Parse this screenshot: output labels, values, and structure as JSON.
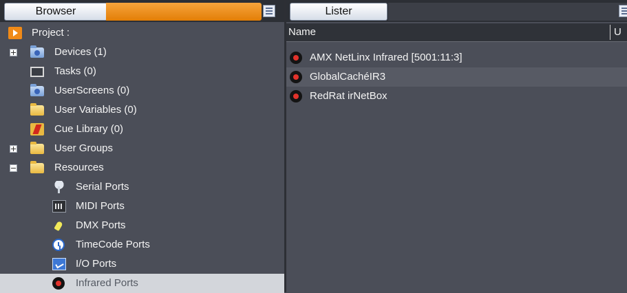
{
  "browser": {
    "tab_label": "Browser",
    "tree": [
      {
        "label": "Project :",
        "icon": "project-icon",
        "expander": null,
        "indent": 0
      },
      {
        "label": "Devices (1)",
        "icon": "devices-folder-icon",
        "expander": "plus",
        "indent": 1
      },
      {
        "label": "Tasks (0)",
        "icon": "tasks-icon",
        "expander": null,
        "indent": 1
      },
      {
        "label": "UserScreens (0)",
        "icon": "userscreens-folder-icon",
        "expander": null,
        "indent": 1
      },
      {
        "label": "User Variables (0)",
        "icon": "folder-icon",
        "expander": null,
        "indent": 1
      },
      {
        "label": "Cue Library (0)",
        "icon": "cue-library-icon",
        "expander": null,
        "indent": 1
      },
      {
        "label": "User Groups",
        "icon": "folder-icon",
        "expander": "plus",
        "indent": 1
      },
      {
        "label": "Resources",
        "icon": "folder-icon",
        "expander": "minus",
        "indent": 1
      },
      {
        "label": "Serial Ports",
        "icon": "serial-port-icon",
        "expander": null,
        "indent": 2
      },
      {
        "label": "MIDI Ports",
        "icon": "midi-port-icon",
        "expander": null,
        "indent": 2
      },
      {
        "label": "DMX Ports",
        "icon": "dmx-port-icon",
        "expander": null,
        "indent": 2
      },
      {
        "label": "TimeCode Ports",
        "icon": "timecode-clock-icon",
        "expander": null,
        "indent": 2
      },
      {
        "label": "I/O Ports",
        "icon": "io-port-icon",
        "expander": null,
        "indent": 2
      },
      {
        "label": "Infrared Ports",
        "icon": "infrared-port-icon",
        "expander": null,
        "indent": 2,
        "selected": true
      }
    ]
  },
  "lister": {
    "tab_label": "Lister",
    "columns": [
      "Name",
      "U"
    ],
    "rows": [
      {
        "name": "AMX NetLinx Infrared [5001:11:3]",
        "icon": "infrared-port-icon"
      },
      {
        "name": "GlobalCachéIR3",
        "icon": "infrared-port-icon"
      },
      {
        "name": "RedRat irNetBox",
        "icon": "infrared-port-icon"
      }
    ]
  },
  "colors": {
    "background": "#4b4e58",
    "tab_accent": "#f08a17",
    "selection": "#d3d6db",
    "header": "#2f3238"
  }
}
